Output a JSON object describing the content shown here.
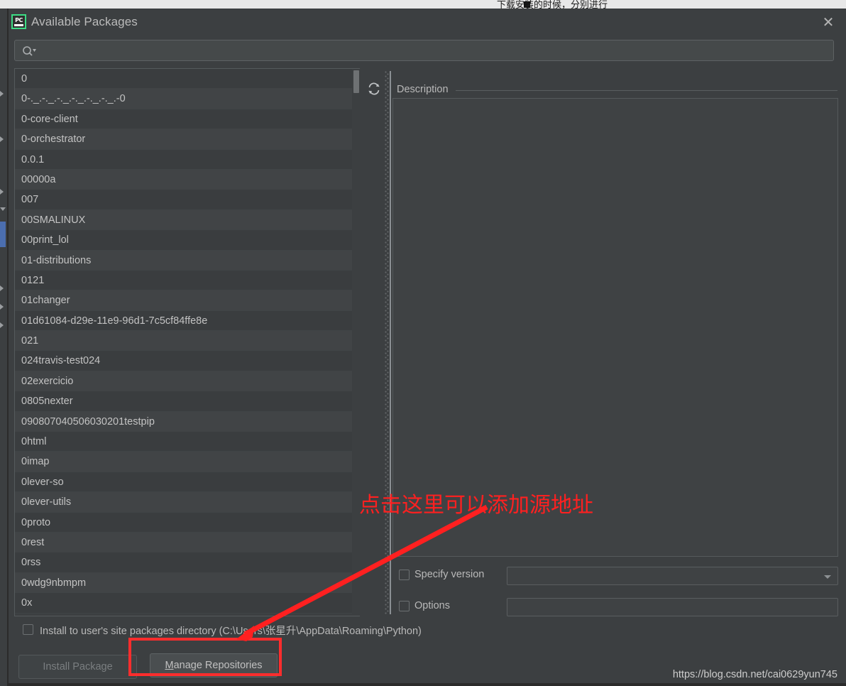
{
  "window": {
    "title": "Available Packages",
    "app_icon": "pycharm-icon",
    "app_icon_text": "PC",
    "close_label": "✕"
  },
  "search": {
    "value": "",
    "placeholder": "",
    "icon": "search-icon"
  },
  "toolbar": {
    "refresh_icon": "refresh-icon"
  },
  "packages": [
    "0",
    "0-._.-._.-._.-._.-._.-._.-0",
    "0-core-client",
    "0-orchestrator",
    "0.0.1",
    "00000a",
    "007",
    "00SMALINUX",
    "00print_lol",
    "01-distributions",
    "0121",
    "01changer",
    "01d61084-d29e-11e9-96d1-7c5cf84ffe8e",
    "021",
    "024travis-test024",
    "02exercicio",
    "0805nexter",
    "090807040506030201testpip",
    "0html",
    "0imap",
    "0lever-so",
    "0lever-utils",
    "0proto",
    "0rest",
    "0rss",
    "0wdg9nbmpm",
    "0x"
  ],
  "description": {
    "label": "Description",
    "body": ""
  },
  "specify_version": {
    "label": "Specify version",
    "checked": false,
    "value": ""
  },
  "options": {
    "label": "Options",
    "checked": false,
    "value": ""
  },
  "user_site": {
    "label": "Install to user's site packages directory (C:\\Users\\张星升\\AppData\\Roaming\\Python)",
    "checked": false
  },
  "buttons": {
    "install_package": "Install Package",
    "manage_repositories_mnemonic": "M",
    "manage_repositories_rest": "anage Repositories"
  },
  "annotation": {
    "text": "点击这里可以添加源地址",
    "color": "#ff2020",
    "highlight_color": "#ff2d2d"
  },
  "watermark": {
    "text": "https://blog.csdn.net/cai0629yun745"
  },
  "background": {
    "top_text": "下载安装的时候，分别进行"
  },
  "colors": {
    "dialog_bg": "#3c3f41",
    "row_alt": "#414446",
    "row_base": "#3a3d3f",
    "text": "#c3c3c3",
    "accent_green": "#3ddc84",
    "selection_blue": "#4b6eaf"
  }
}
